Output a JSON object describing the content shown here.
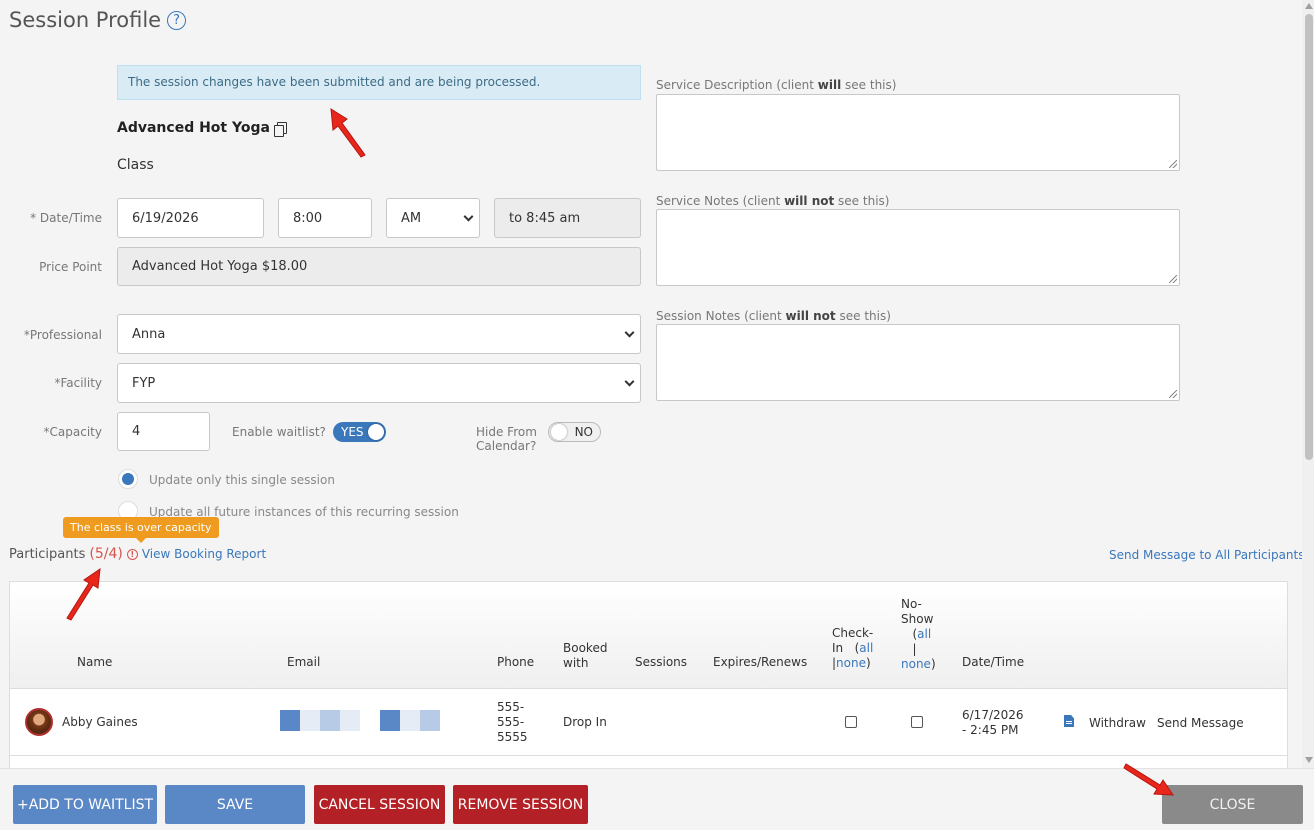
{
  "header": {
    "title": "Session Profile",
    "help": "?"
  },
  "alert": {
    "text": "The session changes have been submitted and are being processed."
  },
  "service": {
    "name": "Advanced Hot Yoga",
    "type": "Class"
  },
  "form": {
    "datetime_label": "* Date/Time",
    "date": "6/19/2026",
    "time": "8:00",
    "ampm": "AM",
    "end_time": "to 8:45 am",
    "price_label": "Price Point",
    "price": "Advanced Hot Yoga $18.00",
    "professional_label": "*Professional",
    "professional": "Anna",
    "facility_label": "*Facility",
    "facility": "FYP",
    "capacity_label": "*Capacity",
    "capacity": "4",
    "waitlist_label": "Enable waitlist?",
    "waitlist_toggle": "YES",
    "hide_label_1": "Hide From",
    "hide_label_2": "Calendar?",
    "hide_toggle": "NO",
    "radio_single": "Update only this single session",
    "radio_all": "Update all future instances of this recurring session"
  },
  "notes": {
    "desc_pre": "Service Description (client ",
    "desc_bold": "will",
    "desc_post": " see this)",
    "service_notes_pre": "Service Notes (client ",
    "service_notes_bold": "will not",
    "service_notes_post": " see this)",
    "session_notes_pre": "Session Notes (client ",
    "session_notes_bold": "will not",
    "session_notes_post": " see this)"
  },
  "participants": {
    "tooltip": "The class is over capacity",
    "label": "Participants",
    "count": "(5/4)",
    "warn": "!",
    "report_link": "View Booking Report",
    "send_all_link": "Send Message to All Participants",
    "columns": {
      "name": "Name",
      "email": "Email",
      "phone": "Phone",
      "booked_1": "Booked",
      "booked_2": "with",
      "sessions": "Sessions",
      "expires": "Expires/Renews",
      "checkin_1": "Check-",
      "checkin_2": "In",
      "all": "all",
      "none": "none",
      "noshow_1": "No-",
      "noshow_2": "Show",
      "datetime": "Date/Time"
    },
    "rows": [
      {
        "name": "Abby Gaines",
        "phone_1": "555-",
        "phone_2": "555-",
        "phone_3": "5555",
        "booked_with": "Drop In",
        "date_1": "6/17/2026",
        "date_2": "- 2:45 PM",
        "withdraw": "Withdraw",
        "send_message": "Send Message"
      }
    ]
  },
  "footer": {
    "add_waitlist": "+ADD TO WAITLIST",
    "save": "SAVE",
    "cancel_session": "CANCEL SESSION",
    "remove_session": "REMOVE SESSION",
    "close": "CLOSE"
  },
  "colors": {
    "accent": "#3a77bb",
    "danger": "#b32025",
    "alert_bg": "#d9ecf5",
    "tooltip": "#ef9b20"
  }
}
